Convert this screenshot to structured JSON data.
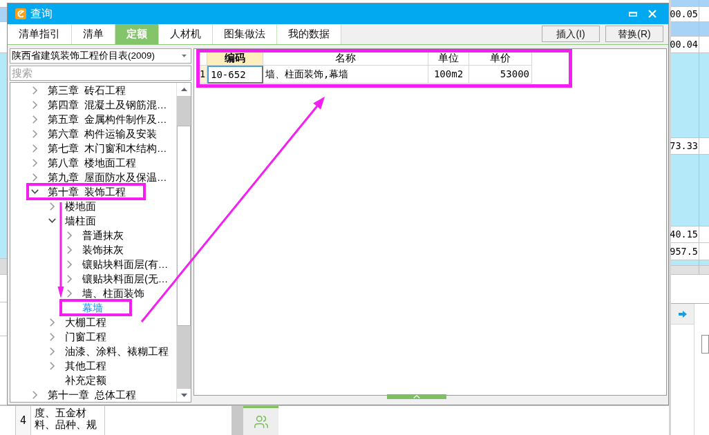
{
  "background_app": {
    "side_table": {
      "values": [
        "00.05",
        "00.04",
        "73.33",
        "40.15",
        "957.5"
      ]
    },
    "bottom_table": {
      "row_number": "4",
      "text": "度、五金材料、品种、规"
    }
  },
  "dialog": {
    "title": "查询",
    "tabs": [
      {
        "label": "清单指引",
        "selected": false
      },
      {
        "label": "清单",
        "selected": false
      },
      {
        "label": "定额",
        "selected": true
      },
      {
        "label": "人材机",
        "selected": false
      },
      {
        "label": "图集做法",
        "selected": false
      },
      {
        "label": "我的数据",
        "selected": false
      }
    ],
    "buttons": [
      "插入(I)",
      "替换(R)"
    ],
    "library_select": {
      "value": "陕西省建筑装饰工程价目表(2009)"
    },
    "search": {
      "placeholder": "搜索"
    },
    "tree": [
      {
        "label": "第三章  砖石工程",
        "kind": "branch",
        "expanded": false,
        "selected": false
      },
      {
        "label": "第四章  混凝土及钢筋混…",
        "kind": "branch",
        "expanded": false,
        "selected": false
      },
      {
        "label": "第五章  金属构件制作及…",
        "kind": "branch",
        "expanded": false,
        "selected": false
      },
      {
        "label": "第六章  构件运输及安装",
        "kind": "branch",
        "expanded": false,
        "selected": false
      },
      {
        "label": "第七章  木门窗和木结构…",
        "kind": "branch",
        "expanded": false,
        "selected": false
      },
      {
        "label": "第八章  楼地面工程",
        "kind": "branch",
        "expanded": false,
        "selected": false
      },
      {
        "label": "第九章  屋面防水及保温…",
        "kind": "branch",
        "expanded": false,
        "selected": false
      },
      {
        "label": "第十章  装饰工程",
        "kind": "branch",
        "expanded": true,
        "selected": false,
        "children": [
          {
            "label": "楼地面",
            "kind": "branch",
            "expanded": false,
            "selected": false
          },
          {
            "label": "墙柱面",
            "kind": "branch",
            "expanded": true,
            "selected": false,
            "children": [
              {
                "label": "普通抹灰",
                "kind": "branch",
                "expanded": false,
                "selected": false
              },
              {
                "label": "装饰抹灰",
                "kind": "branch",
                "expanded": false,
                "selected": false
              },
              {
                "label": "镶贴块料面层(有…",
                "kind": "branch",
                "expanded": false,
                "selected": false
              },
              {
                "label": "镶贴块料面层(无…",
                "kind": "branch",
                "expanded": false,
                "selected": false
              },
              {
                "label": "墙、柱面装饰",
                "kind": "branch",
                "expanded": false,
                "selected": false
              },
              {
                "label": "幕墙",
                "kind": "leaf",
                "selected": true
              }
            ]
          },
          {
            "label": "大棚工程",
            "kind": "branch",
            "expanded": false,
            "selected": false
          },
          {
            "label": "门窗工程",
            "kind": "branch",
            "expanded": false,
            "selected": false
          },
          {
            "label": "油漆、涂料、裱糊工程",
            "kind": "branch",
            "expanded": false,
            "selected": false
          },
          {
            "label": "其他工程",
            "kind": "branch",
            "expanded": false,
            "selected": false
          },
          {
            "label": "补充定额",
            "kind": "leaf",
            "selected": false
          }
        ]
      },
      {
        "label": "第十一章  总体工程",
        "kind": "branch",
        "expanded": false,
        "selected": false
      }
    ],
    "table": {
      "columns": [
        {
          "label": "编码",
          "selected": true
        },
        {
          "label": "名称",
          "selected": false
        },
        {
          "label": "单位",
          "selected": false
        },
        {
          "label": "单价",
          "selected": false
        }
      ],
      "rows": [
        {
          "number": "1",
          "selected": true,
          "cells": [
            "10-652",
            "墙、柱面装饰,幕墙",
            "100m2",
            "53000"
          ]
        }
      ]
    }
  }
}
